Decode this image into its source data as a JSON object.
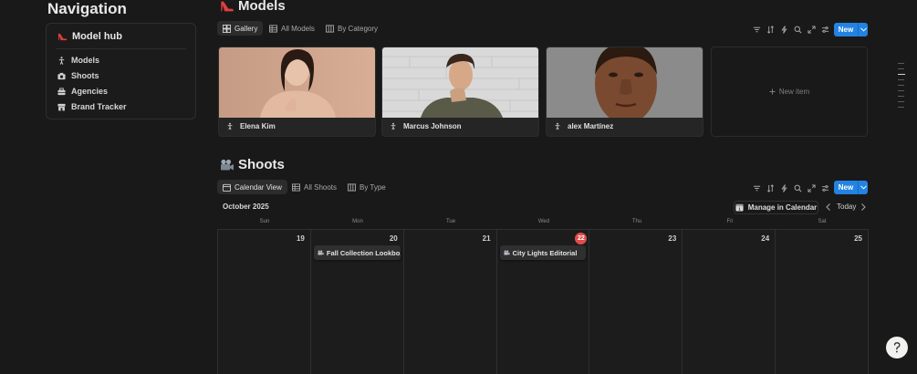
{
  "navigation": {
    "title": "Navigation",
    "hub_title": "Model hub",
    "items": [
      {
        "label": "Models",
        "icon": "person-standing-icon"
      },
      {
        "label": "Shoots",
        "icon": "camera-icon"
      },
      {
        "label": "Agencies",
        "icon": "briefcase-icon"
      },
      {
        "label": "Brand Tracker",
        "icon": "store-icon"
      }
    ]
  },
  "models": {
    "title": "Models",
    "title_icon": "high-heel-icon",
    "tabs": [
      {
        "label": "Gallery",
        "icon": "gallery-icon",
        "active": true
      },
      {
        "label": "All Models",
        "icon": "table-icon",
        "active": false
      },
      {
        "label": "By Category",
        "icon": "board-icon",
        "active": false
      }
    ],
    "new_label": "New",
    "cards": [
      {
        "name": "Elena Kim"
      },
      {
        "name": "Marcus Johnson"
      },
      {
        "name": "alex Martínez"
      }
    ],
    "new_item_label": "New item"
  },
  "shoots": {
    "title": "Shoots",
    "title_icon": "movie-camera-icon",
    "tabs": [
      {
        "label": "Calendar View",
        "icon": "calendar-icon",
        "active": true
      },
      {
        "label": "All Shoots",
        "icon": "table-icon",
        "active": false
      },
      {
        "label": "By Type",
        "icon": "board-icon",
        "active": false
      }
    ],
    "new_label": "New",
    "calendar": {
      "month_label": "October 2025",
      "manage_label": "Manage in Calendar",
      "today_label": "Today",
      "weekdays": [
        "Sun",
        "Mon",
        "Tue",
        "Wed",
        "Thu",
        "Fri",
        "Sat"
      ],
      "days": [
        "19",
        "20",
        "21",
        "22",
        "23",
        "24",
        "25"
      ],
      "current_day": "22",
      "events": [
        {
          "day": "20",
          "label": "Fall Collection Lookbo..."
        },
        {
          "day": "22",
          "label": "City Lights Editorial"
        }
      ]
    }
  },
  "colors": {
    "background": "#191919",
    "accent": "#2383e2",
    "today_badge": "#e14c4c",
    "heel_icon": "#e03e3e"
  }
}
